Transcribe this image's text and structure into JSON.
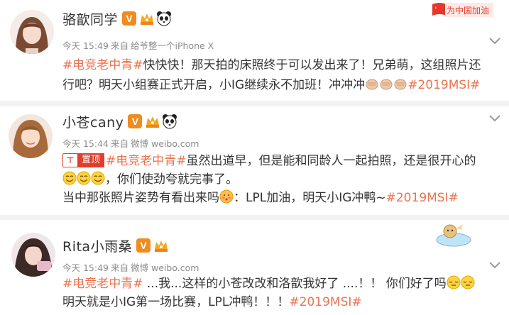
{
  "colors": {
    "accent": "#eb7350",
    "pin_red": "#e03e2d",
    "vip_orange": "#f08b1d",
    "meta_gray": "#8b8b8b"
  },
  "posts": [
    {
      "name": "骆歆同学",
      "time": "今天 15:49",
      "from_label": "来自",
      "source": "给爷整一个iPhone X",
      "icons": [
        "avatar",
        "verified-v-badge",
        "vip-crown-icon",
        "panda-emoji-icon",
        "chevron-down-icon"
      ],
      "text_lines": [
        {
          "tag": "#电竞老中青#",
          "text": "快快快！那天拍的床照终于可以发出来了！兄弟萌，这组照片还"
        },
        {
          "text": "行吧？明天小组赛正式开启，小IG继续永不加班！冲冲冲",
          "emoji_count": 3,
          "tail_tag": "#2019MSI#"
        }
      ]
    },
    {
      "name": "小苍cany",
      "time": "今天 15:44",
      "from_label": "来自",
      "source": "微博 weibo.com",
      "pinned_label": "置顶",
      "text_lines": [
        {
          "tag": "#电竞老中青#",
          "text": "虽然出道早，但是能和同龄人一起拍照，还是很开心的"
        },
        {
          "emoji_count": 3,
          "text": "，你们使劲夸就完事了。"
        },
        {
          "text": "当中那张照片姿势有看出来吗",
          "text2": "：LPL加油，明天小IG冲鸭~",
          "tail_tag": "#2019MSI#"
        }
      ]
    },
    {
      "name": "Rita小雨桑",
      "time": "今天 15:49",
      "from_label": "来自",
      "source": "微博 weibo.com",
      "text_lines": [
        {
          "tag": "#电竞老中青#",
          "text": " ...我...这样的小苍改改和洛歆我好了 ....！！ 你们好了吗"
        },
        {
          "text": "明天就是小IG第一场比赛，LPL冲鸭！！！",
          "tail_tag": "#2019MSI#"
        }
      ]
    }
  ],
  "promo_badge": "为中国加油"
}
